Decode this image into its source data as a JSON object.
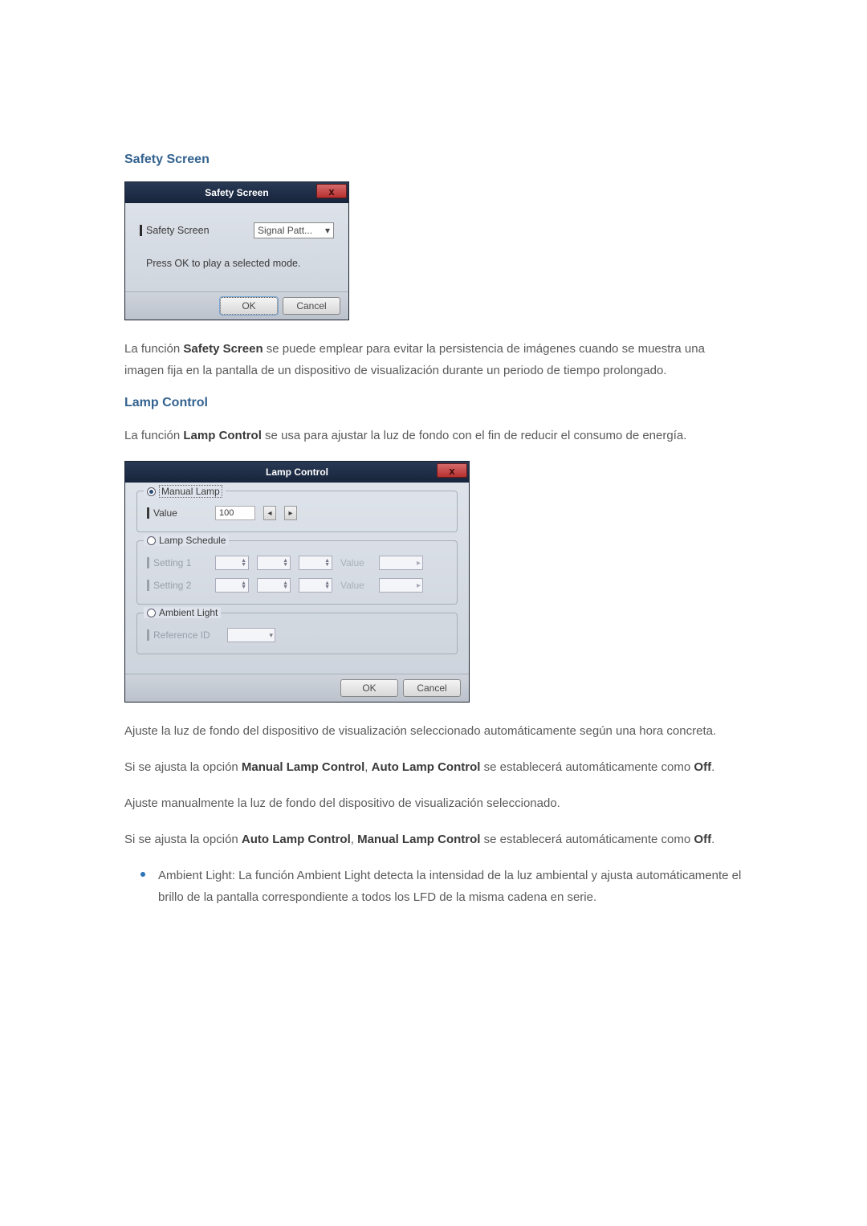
{
  "section1": {
    "title": "Safety Screen",
    "dialog": {
      "title": "Safety Screen",
      "close": "x",
      "label": "Safety Screen",
      "selectValue": "Signal Patt...",
      "instruction": "Press OK to play a selected mode.",
      "ok": "OK",
      "cancel": "Cancel"
    },
    "para": {
      "t1": "La función ",
      "b1": "Safety Screen",
      "t2": " se puede emplear para evitar la persistencia de imágenes cuando se muestra una imagen fija en la pantalla de un dispositivo de visualización durante un periodo de tiempo prolongado."
    }
  },
  "section2": {
    "title": "Lamp Control",
    "intro": {
      "t1": "La función ",
      "b1": "Lamp Control",
      "t2": " se usa para ajustar la luz de fondo con el fin de reducir el consumo de energía."
    },
    "dialog": {
      "title": "Lamp Control",
      "close": "x",
      "group1": {
        "legend": "Manual Lamp",
        "rowLabel": "Value",
        "value": "100"
      },
      "group2": {
        "legend": "Lamp Schedule",
        "row1Label": "Setting 1",
        "row2Label": "Setting 2",
        "valueLabel": "Value"
      },
      "group3": {
        "legend": "Ambient Light",
        "rowLabel": "Reference ID"
      },
      "ok": "OK",
      "cancel": "Cancel"
    },
    "p1": "Ajuste la luz de fondo del dispositivo de visualización seleccionado automáticamente según una hora concreta.",
    "p2": {
      "t1": "Si se ajusta la opción ",
      "b1": "Manual Lamp Control",
      "t2": ", ",
      "b2": "Auto Lamp Control",
      "t3": " se establecerá automáticamente como ",
      "b3": "Off",
      "t4": "."
    },
    "p3": "Ajuste manualmente la luz de fondo del dispositivo de visualización seleccionado.",
    "p4": {
      "t1": "Si se ajusta la opción ",
      "b1": "Auto Lamp Control",
      "t2": ", ",
      "b2": "Manual Lamp Control",
      "t3": " se establecerá automáticamente como ",
      "b3": "Off",
      "t4": "."
    },
    "bullet": {
      "b1": "Ambient Light",
      "t1": ": La función ",
      "b2": "Ambient Light",
      "t2": " detecta la intensidad de la luz ambiental y ajusta automáticamente el brillo de la pantalla correspondiente a todos los LFD de la misma cadena en serie."
    }
  }
}
